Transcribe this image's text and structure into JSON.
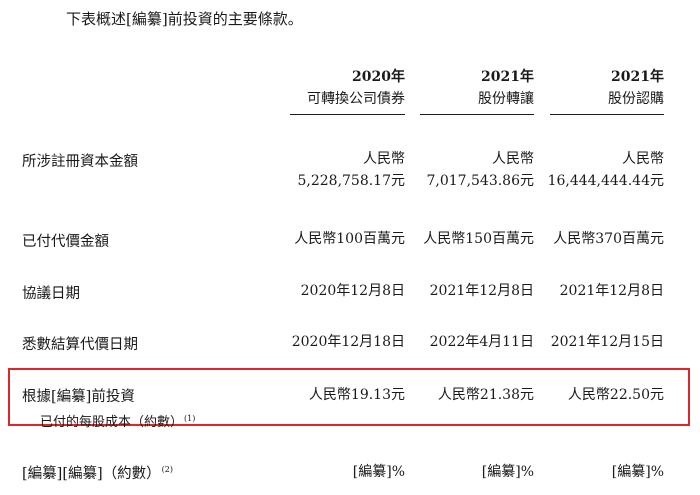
{
  "intro": "下表概述[編纂]前投資的主要條款。",
  "columns": [
    {
      "year": "2020年",
      "name": "可轉換公司債券"
    },
    {
      "year": "2021年",
      "name": "股份轉讓"
    },
    {
      "year": "2021年",
      "name": "股份認購"
    }
  ],
  "rows": {
    "registered_capital": {
      "label": "所涉註冊資本金額",
      "values": [
        {
          "line1": "人民幣",
          "line2": "5,228,758.17元"
        },
        {
          "line1": "人民幣",
          "line2": "7,017,543.86元"
        },
        {
          "line1": "人民幣",
          "line2": "16,444,444.44元"
        }
      ]
    },
    "consideration_paid": {
      "label": "已付代價金額",
      "values": [
        "人民幣100百萬元",
        "人民幣150百萬元",
        "人民幣370百萬元"
      ]
    },
    "agreement_date": {
      "label": "協議日期",
      "values": [
        "2020年12月8日",
        "2021年12月8日",
        "2021年12月8日"
      ]
    },
    "settlement_date": {
      "label": "悉數結算代價日期",
      "values": [
        "2020年12月18日",
        "2022年4月11日",
        "2021年12月15日"
      ]
    },
    "cost_per_share": {
      "label": "根據[編纂]前投資",
      "label2": "已付的每股成本（約數）",
      "note": "(1)",
      "values": [
        "人民幣19.13元",
        "人民幣21.38元",
        "人民幣22.50元"
      ]
    },
    "percentage": {
      "label": "[編纂][編纂]（約數）",
      "note": "(2)",
      "values": [
        "[編纂]%",
        "[編纂]%",
        "[編纂]%"
      ]
    }
  },
  "colors": {
    "highlight_border": "#e0262b",
    "text": "#1a1a1a"
  }
}
